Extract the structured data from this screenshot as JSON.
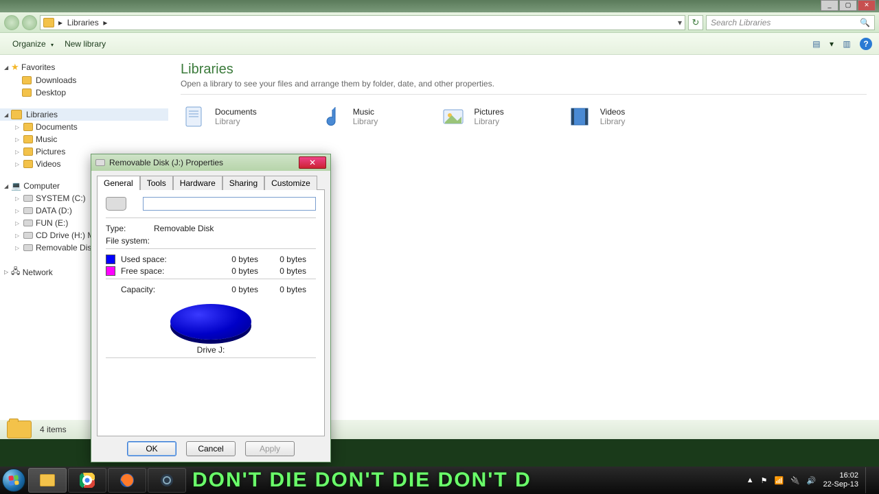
{
  "window_controls": {
    "min": "_",
    "max": "▢",
    "close": "✕"
  },
  "breadcrumb": {
    "root": "Libraries",
    "sep": "▸",
    "dropdown": "▾",
    "refresh": "↻"
  },
  "search": {
    "placeholder": "Search Libraries",
    "icon": "🔍"
  },
  "toolbar": {
    "organize": "Organize",
    "dd": "▾",
    "newlib": "New library",
    "view_icon": "▤",
    "pane_icon": "▥",
    "help": "?"
  },
  "sidebar": {
    "favorites": {
      "label": "Favorites",
      "items": [
        "Downloads",
        "Desktop"
      ]
    },
    "libraries": {
      "label": "Libraries",
      "items": [
        "Documents",
        "Music",
        "Pictures",
        "Videos"
      ]
    },
    "computer": {
      "label": "Computer",
      "items": [
        "SYSTEM (C:)",
        "DATA (D:)",
        "FUN (E:)",
        "CD Drive (H:) M…",
        "Removable Disk (…"
      ]
    },
    "network": {
      "label": "Network"
    }
  },
  "main": {
    "heading": "Libraries",
    "sub": "Open a library to see your files and arrange them by folder, date, and other properties.",
    "item_type": "Library",
    "items": [
      "Documents",
      "Music",
      "Pictures",
      "Videos"
    ]
  },
  "status": {
    "text": "4 items"
  },
  "taskbar": {
    "wallpaper_text": "DON'T DIE DON'T DIE DON'T D",
    "tray_up": "▲",
    "clock_time": "16:02",
    "clock_date": "22-Sep-13"
  },
  "dialog": {
    "title": "Removable Disk (J:) Properties",
    "close": "✕",
    "tabs": [
      "General",
      "Tools",
      "Hardware",
      "Sharing",
      "Customize"
    ],
    "active_tab": 0,
    "name_value": "",
    "type_label": "Type:",
    "type_value": "Removable Disk",
    "fs_label": "File system:",
    "used_label": "Used space:",
    "used_b": "0 bytes",
    "used_b2": "0 bytes",
    "free_label": "Free space:",
    "free_b": "0 bytes",
    "free_b2": "0 bytes",
    "cap_label": "Capacity:",
    "cap_b": "0 bytes",
    "cap_b2": "0 bytes",
    "drive_label": "Drive J:",
    "ok": "OK",
    "cancel": "Cancel",
    "apply": "Apply",
    "colors": {
      "used": "#0000ff",
      "free": "#ff00ff"
    }
  }
}
